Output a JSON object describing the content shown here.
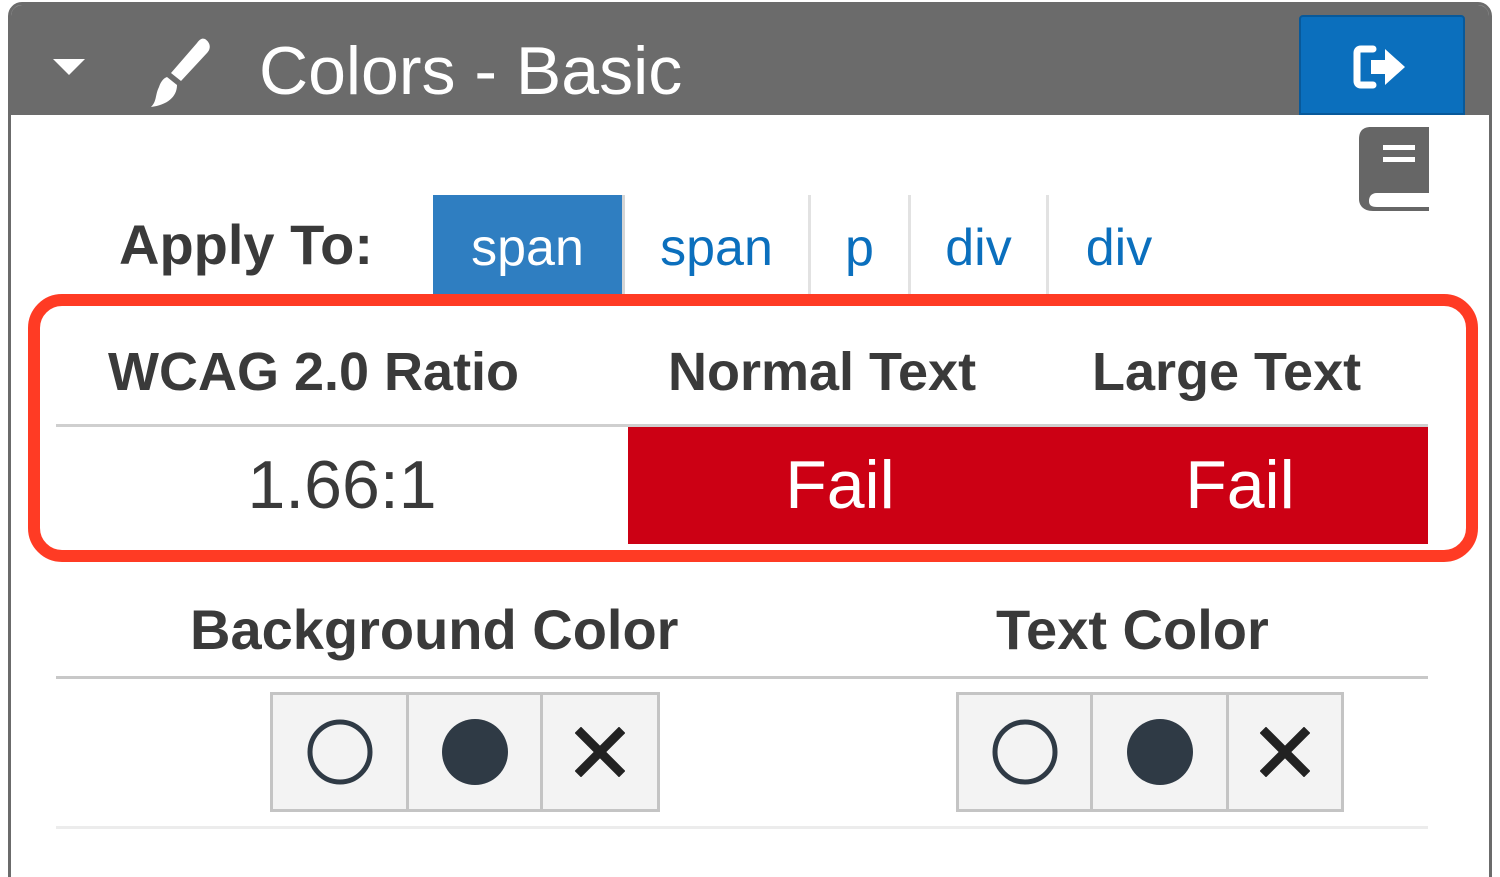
{
  "header": {
    "title": "Colors - Basic",
    "collapse_icon": "caret-down-icon",
    "title_icon": "paintbrush-icon",
    "exit_icon": "sign-out-icon",
    "background": "#6b6b6b",
    "exit_button_color": "#0b6fbd"
  },
  "help_icon": "book-icon",
  "apply_to": {
    "label": "Apply To:",
    "tabs": [
      {
        "label": "span",
        "active": true
      },
      {
        "label": "span",
        "active": false
      },
      {
        "label": "p",
        "active": false
      },
      {
        "label": "div",
        "active": false
      },
      {
        "label": "div",
        "active": false
      }
    ]
  },
  "contrast": {
    "headers": {
      "ratio": "WCAG 2.0 Ratio",
      "normal": "Normal Text",
      "large": "Large Text"
    },
    "ratio": "1.66:1",
    "normal_result": "Fail",
    "large_result": "Fail",
    "fail_color": "#cc0014",
    "highlight_color": "#ff3b24"
  },
  "colors": {
    "background_label": "Background Color",
    "text_color_label": "Text Color",
    "button_icons": [
      "empty-circle-icon",
      "filled-circle-icon",
      "clear-x-icon"
    ]
  }
}
